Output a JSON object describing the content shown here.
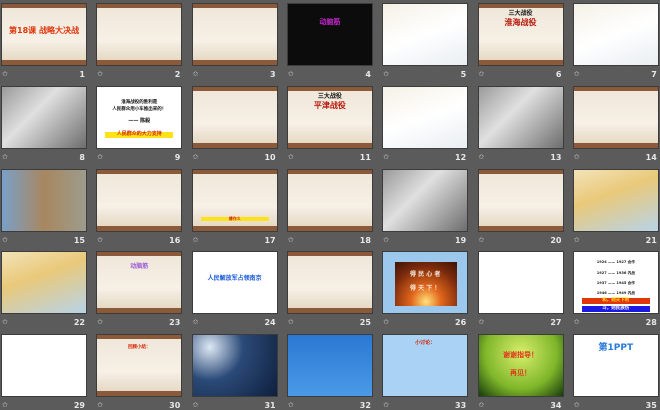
{
  "view": "slide-sorter",
  "transition_icon": "transition-star-icon",
  "colors": {
    "background": "#5b5b5b",
    "number": "#e8e8e8",
    "accent_red": "#d42a0a"
  },
  "slides": [
    {
      "number": "1",
      "style": "paper",
      "texts": [
        {
          "t": "第18课 战略大决战",
          "c": "#e0360c",
          "s": 8,
          "y": 22
        }
      ]
    },
    {
      "number": "2",
      "style": "paper",
      "texts": []
    },
    {
      "number": "3",
      "style": "paper",
      "texts": []
    },
    {
      "number": "4",
      "style": "black",
      "texts": [
        {
          "t": "动脑筋",
          "c": "#c026c8",
          "s": 7,
          "y": 14
        }
      ]
    },
    {
      "number": "5",
      "style": "map",
      "texts": []
    },
    {
      "number": "6",
      "style": "paper",
      "texts": [
        {
          "t": "三大战役",
          "c": "#111111",
          "s": 6,
          "y": 7
        },
        {
          "t": "淮海战役",
          "c": "#b8180c",
          "s": 8,
          "y": 14
        }
      ]
    },
    {
      "number": "7",
      "style": "map",
      "texts": []
    },
    {
      "number": "8",
      "style": "photo",
      "texts": []
    },
    {
      "number": "9",
      "style": "white",
      "texts": [
        {
          "t": "淮海战役的胜利是",
          "c": "#111111",
          "s": 4.5,
          "y": 13
        },
        {
          "t": "人民群众用小车推出来的！",
          "c": "#111111",
          "s": 4.5,
          "y": 20
        },
        {
          "t": "—— 陈毅",
          "c": "#111111",
          "s": 5,
          "y": 32
        },
        {
          "t": "人民群众的大力支持",
          "c": "#d42a0a",
          "s": 5,
          "y": 45,
          "bg": "#ffe21a"
        }
      ]
    },
    {
      "number": "10",
      "style": "paper",
      "texts": []
    },
    {
      "number": "11",
      "style": "paper",
      "texts": [
        {
          "t": "三大战役",
          "c": "#111111",
          "s": 6,
          "y": 7
        },
        {
          "t": "平津战役",
          "c": "#b8180c",
          "s": 8,
          "y": 14
        }
      ]
    },
    {
      "number": "12",
      "style": "map",
      "texts": []
    },
    {
      "number": "13",
      "style": "photo",
      "texts": []
    },
    {
      "number": "14",
      "style": "paper",
      "texts": []
    },
    {
      "number": "15",
      "style": "imgs",
      "texts": []
    },
    {
      "number": "16",
      "style": "paper",
      "texts": []
    },
    {
      "number": "17",
      "style": "paper",
      "texts": [
        {
          "t": "傅作义",
          "c": "#d42a0a",
          "s": 4,
          "y": 47,
          "bg": "#ffe21a"
        }
      ]
    },
    {
      "number": "18",
      "style": "paper",
      "texts": []
    },
    {
      "number": "19",
      "style": "photo",
      "texts": []
    },
    {
      "number": "20",
      "style": "paper",
      "texts": []
    },
    {
      "number": "21",
      "style": "colormap",
      "texts": []
    },
    {
      "number": "22",
      "style": "colormap",
      "texts": []
    },
    {
      "number": "23",
      "style": "paper",
      "texts": [
        {
          "t": "动脑筋",
          "c": "#a060d8",
          "s": 6,
          "y": 12
        }
      ]
    },
    {
      "number": "24",
      "style": "white",
      "texts": [
        {
          "t": "人民解放军占领南京",
          "c": "#1a5ad8",
          "s": 6,
          "y": 24
        }
      ]
    },
    {
      "number": "25",
      "style": "paper",
      "texts": []
    },
    {
      "number": "26",
      "style": "sun",
      "texts": [
        {
          "t": "得 民 心 者",
          "c": "#f4e8d8",
          "s": 6,
          "y": 20
        },
        {
          "t": "得 天 下 ！",
          "c": "#f4e8d8",
          "s": 6,
          "y": 34
        }
      ]
    },
    {
      "number": "27",
      "style": "white",
      "texts": []
    },
    {
      "number": "28",
      "style": "white",
      "texts": [
        {
          "t": "1924 —— 1927   合作",
          "c": "#222222",
          "s": 3.6,
          "y": 8
        },
        {
          "t": "1927 —— 1936   内战",
          "c": "#222222",
          "s": 3.6,
          "y": 19
        },
        {
          "t": "1937 —— 1945   合作",
          "c": "#222222",
          "s": 3.6,
          "y": 29
        },
        {
          "t": "1946 —— 1949   内战",
          "c": "#222222",
          "s": 3.6,
          "y": 39
        },
        {
          "t": "和，则天下利",
          "c": "#ffe21a",
          "s": 4.5,
          "y": 46,
          "bg": "#e0360c"
        },
        {
          "t": "斗，则民族伤",
          "c": "#ffffff",
          "s": 4.5,
          "y": 54,
          "bg": "#1a1ae0"
        }
      ]
    },
    {
      "number": "29",
      "style": "white",
      "texts": []
    },
    {
      "number": "30",
      "style": "paper",
      "texts": [
        {
          "t": "回顾小结：",
          "c": "#d42a0a",
          "s": 4.5,
          "y": 10
        }
      ]
    },
    {
      "number": "31",
      "style": "night",
      "texts": []
    },
    {
      "number": "32",
      "style": "blue",
      "texts": []
    },
    {
      "number": "33",
      "style": "lightblue",
      "texts": [
        {
          "t": "小讨论：",
          "c": "#d42a0a",
          "s": 5,
          "y": 6
        }
      ]
    },
    {
      "number": "34",
      "style": "green",
      "texts": [
        {
          "t": "谢谢指导！",
          "c": "#e0361c",
          "s": 7,
          "y": 16
        },
        {
          "t": "再见！",
          "c": "#e0361c",
          "s": 7,
          "y": 34
        }
      ]
    },
    {
      "number": "35",
      "style": "white",
      "texts": [
        {
          "t": "第1PPT",
          "c": "#2a7ad8",
          "s": 9,
          "y": 8
        }
      ]
    }
  ]
}
